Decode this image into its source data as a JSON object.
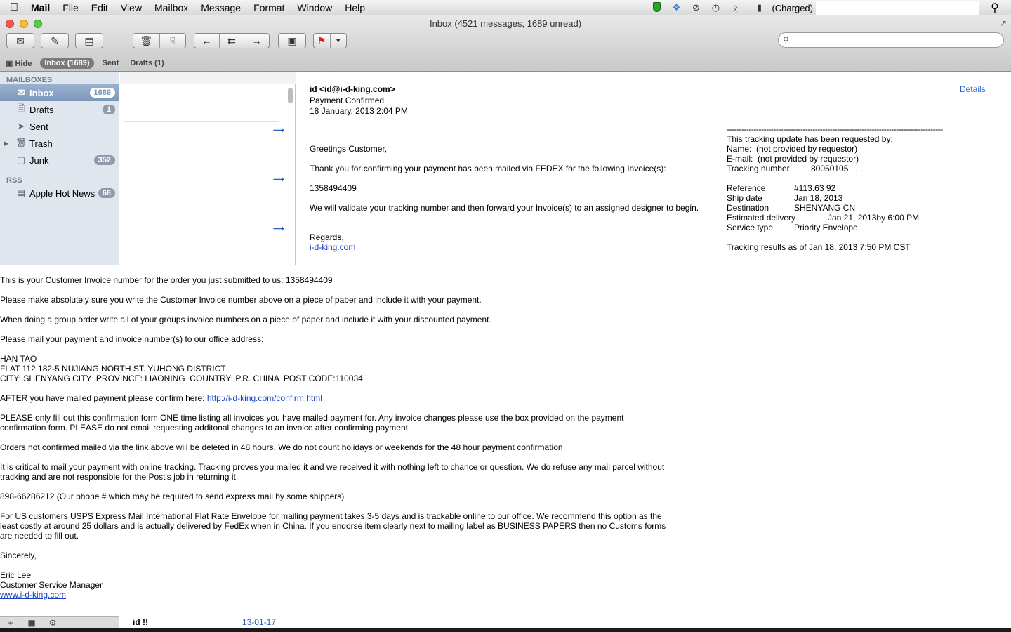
{
  "menubar": {
    "app": "Mail",
    "items": [
      "File",
      "Edit",
      "View",
      "Mailbox",
      "Message",
      "Format",
      "Window",
      "Help"
    ],
    "battery": "(Charged)"
  },
  "window": {
    "title": "Inbox (4521 messages, 1689 unread)"
  },
  "favorites": {
    "hide": "Hide",
    "inbox": "Inbox (1689)",
    "sent": "Sent",
    "drafts": "Drafts (1)"
  },
  "search": {
    "placeholder": ""
  },
  "sidebar": {
    "mailboxes_header": "MAILBOXES",
    "items": [
      {
        "label": "Inbox",
        "badge": "1689"
      },
      {
        "label": "Drafts",
        "badge": "1"
      },
      {
        "label": "Sent",
        "badge": ""
      },
      {
        "label": "Trash",
        "badge": ""
      },
      {
        "label": "Junk",
        "badge": "352"
      }
    ],
    "rss_header": "RSS",
    "rss_items": [
      {
        "label": "Apple Hot News",
        "badge": "68"
      }
    ]
  },
  "message": {
    "from": "id <id@i-d-king.com>",
    "subject": "Payment Confirmed",
    "date": "18 January, 2013 2:04 PM",
    "details": "Details",
    "greeting": "Greetings Customer,",
    "p1": "Thank you for confirming your payment has been mailed via FEDEX for the following Invoice(s):",
    "invoice": "1358494409",
    "p2": "We will validate your tracking number and then forward your Invoice(s) to an assigned designer to begin.",
    "regards": "Regards,",
    "sig_link": "i-d-king.com"
  },
  "tracking": {
    "dashes": "----------------------------------------------------------------------------------------",
    "intro": "This tracking update has been requested by:",
    "name": "Name:  (not provided by requestor)",
    "email": "E-mail:  (not provided by requestor)",
    "tracking_label": "Tracking number",
    "tracking_value": "80050105 . . .",
    "reference_label": "Reference",
    "reference_value": "#113.63 92",
    "ship_label": "Ship date",
    "ship_value": "Jan 18, 2013",
    "dest_label": "Destination",
    "dest_value": "SHENYANG CN",
    "est_label": "Estimated delivery",
    "est_value": "Jan 21, 2013by 6:00 PM",
    "service_label": "Service type",
    "service_value": "Priority Envelope",
    "results": "Tracking results as of Jan 18, 2013 7:50 PM CST"
  },
  "overlay": {
    "l1": "This is your Customer Invoice number for the order you just submitted to us: 1358494409",
    "l2": "Please make absolutely sure you write the Customer Invoice number above on a piece of paper and include it with your payment.",
    "l3": "When doing a group order write all of your groups invoice numbers on a piece of paper and include it with your discounted payment.",
    "l4": "Please mail your payment and invoice number(s) to our office address:",
    "a1": "HAN TAO",
    "a2": "FLAT 112 182-5 NUJIANG NORTH ST. YUHONG DISTRICT",
    "a3": "CITY: SHENYANG CITY  PROVINCE: LIAONING  COUNTRY: P.R. CHINA  POST CODE:110034",
    "l5": "AFTER you have mailed payment please confirm here: ",
    "l5_link": "http://i-d-king.com/confirm.html",
    "l6a": "PLEASE only fill out this confirmation form ONE time listing all invoices you have mailed payment for. Any invoice changes please use the box provided on the payment",
    "l6b": "confirmation form. PLEASE do not email requesting additonal changes to an invoice after confirming payment.",
    "l7": "Orders not confirmed mailed via the link above will be deleted in 48 hours. We do not count holidays or weekends for the 48 hour payment confirmation",
    "l8a": "It is critical to mail your payment with online tracking. Tracking proves you mailed it and we received it with nothing left to chance or question. We do refuse any mail parcel without",
    "l8b": "tracking and are not responsible for the Post's job in returning it.",
    "l9": "898-66286212 (Our phone # which may be required to send express mail by some shippers)",
    "l10a": "For US customers USPS Express Mail International Flat Rate Envelope for mailing payment takes 3-5 days and is trackable online to our office. We recommend this option as the",
    "l10b": "least costly at around 25 dollars and is actually delivered by FedEx when in China. If you endorse item clearly next to mailing label as BUSINESS PAPERS then no Customs forms",
    "l10c": "are needed to fill out.",
    "s1": "Sincerely,",
    "s2": "Eric Lee",
    "s3": "Customer Service Manager",
    "s4": "www.i-d-king.com"
  },
  "bottom": {
    "sender": "id",
    "flag": "!!",
    "date": "13-01-17"
  }
}
